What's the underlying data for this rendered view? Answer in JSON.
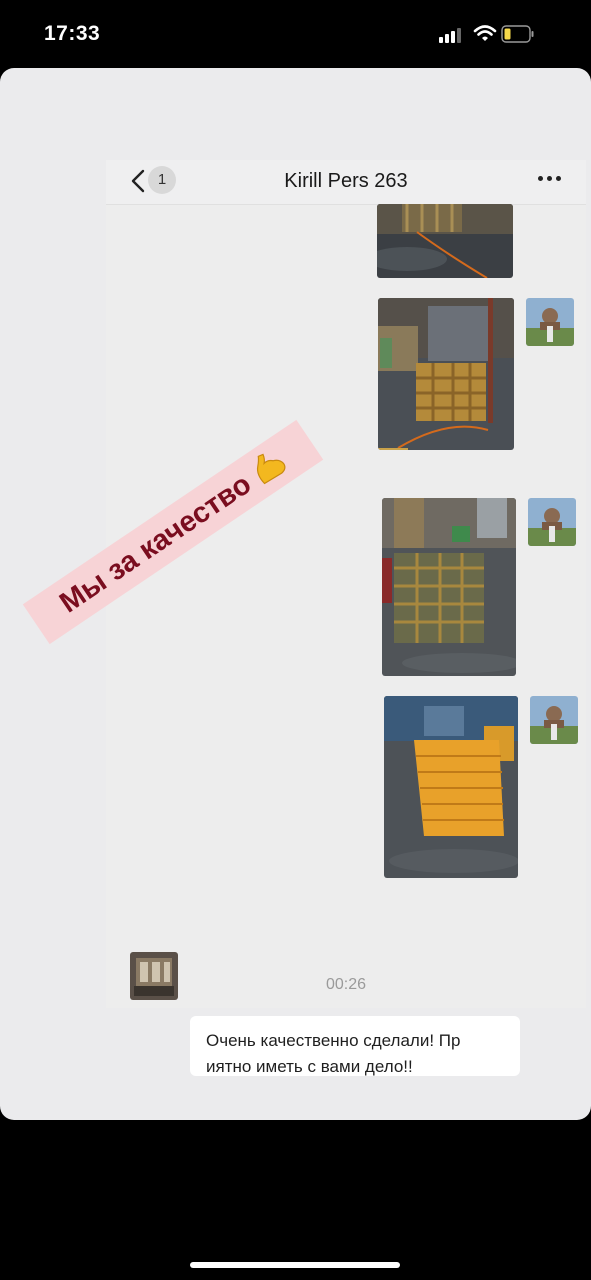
{
  "status_bar": {
    "time": "17:33",
    "icons": [
      "cellular-signal-icon",
      "wifi-icon",
      "battery-icon"
    ],
    "battery_color": "#f5d84a"
  },
  "story": {
    "sticker_text": "Мы за качество",
    "sticker_emoji": "flexed-biceps",
    "sticker_colors": {
      "background": "#f7d3d6",
      "text": "#7a0d1f"
    },
    "chat": {
      "unread_count": "1",
      "title": "Kirill Pers 263",
      "icons": [
        "chevron-left-icon",
        "more-dots-icon"
      ],
      "timestamp": "00:26",
      "incoming_message": "Очень качественно сделали! Пр\nиятно иметь с вами дело!!",
      "outgoing_images": [
        "wooden-crate-photo",
        "crate-warehouse-photo",
        "crates-stack-photo",
        "yellow-stone-pallet-photo"
      ]
    }
  }
}
